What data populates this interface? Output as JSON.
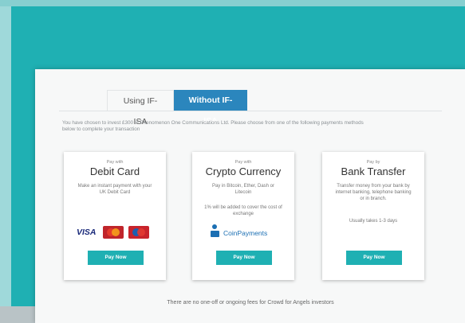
{
  "tabs": [
    {
      "label": "Using IF-ISA"
    },
    {
      "label": "Without IF-ISA"
    }
  ],
  "intro_text": "You have chosen to invest £300 in Phenomenon One Communications Ltd. Please choose from one of the following payments methods below to complete your transaction",
  "cards": {
    "debit": {
      "pre": "Pay with",
      "title": "Debit Card",
      "desc": "Make an instant payment with your UK Debit Card",
      "logo_visa": "VISA",
      "button": "Pay Now"
    },
    "crypto": {
      "pre": "Pay with",
      "title": "Crypto Currency",
      "desc": "Pay in Bitcoin, Ether, Dash or Litecoin",
      "note": "1% will be added to cover the cost of exchange",
      "logo_text": "CoinPayments",
      "button": "Pay Now"
    },
    "bank": {
      "pre": "Pay by",
      "title": "Bank Transfer",
      "desc": "Transfer money from your bank by internet banking, telephone banking or in branch.",
      "note": "Usually takes 1-3 days",
      "button": "Pay Now"
    }
  },
  "footer_text": "There are no one-off or ongoing fees for Crowd for Angels investors",
  "colors": {
    "accent": "#1fb0b3",
    "tab_blue": "#2b86bd",
    "background": "#1fb0b3"
  }
}
